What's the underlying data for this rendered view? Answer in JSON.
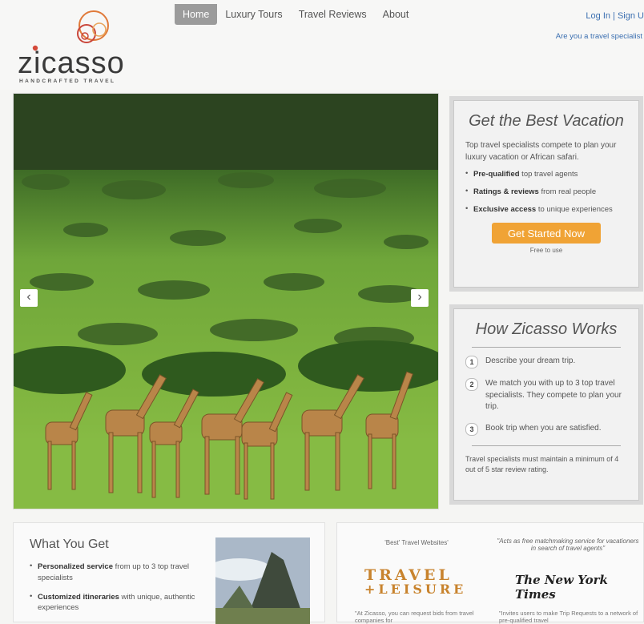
{
  "logo": {
    "name": "zicasso",
    "tagline": "HANDCRAFTED TRAVEL"
  },
  "nav": [
    {
      "label": "Home",
      "active": true
    },
    {
      "label": "Luxury Tours",
      "active": false
    },
    {
      "label": "Travel Reviews",
      "active": false
    },
    {
      "label": "About",
      "active": false
    }
  ],
  "header": {
    "login": "Log In | Sign U",
    "specialist": "Are you a travel specialist"
  },
  "hero": {
    "prev_icon": "chevron-left-icon",
    "next_icon": "chevron-right-icon",
    "prev_glyph": "‹",
    "next_glyph": "›"
  },
  "vacation_panel": {
    "title": "Get the Best Vacation",
    "intro": "Top travel specialists compete to plan your luxury vacation or African safari.",
    "bullets": [
      {
        "strong": "Pre-qualified",
        "rest": " top travel agents"
      },
      {
        "strong": "Ratings & reviews",
        "rest": " from real people"
      },
      {
        "strong": "Exclusive access",
        "rest": " to unique experiences"
      }
    ],
    "cta": "Get Started Now",
    "cta_note": "Free to use",
    "cta_color": "#f0a335"
  },
  "how_panel": {
    "title": "How Zicasso Works",
    "steps": [
      {
        "num": "1",
        "text": "Describe your dream trip."
      },
      {
        "num": "2",
        "text": "We match you with up to 3 top travel specialists. They compete to plan your trip."
      },
      {
        "num": "3",
        "text": "Book trip when you are satisfied."
      }
    ],
    "note": "Travel specialists must maintain a minimum of 4 out of 5 star review rating."
  },
  "what_you_get": {
    "title": "What You Get",
    "items": [
      {
        "strong": "Personalized service",
        "rest": " from up to 3 top travel specialists"
      },
      {
        "strong": "Customized itineraries",
        "rest": " with unique, authentic experiences"
      }
    ]
  },
  "press": {
    "quote_left": "'Best' Travel Websites'",
    "quote_right": "\"Acts as free matchmaking service for vacationers in search of travel agents\"",
    "logo_left_line1": "TRAVEL",
    "logo_left_line2": "+LEISURE",
    "logo_right": "The New York Times",
    "foot_left": "\"At Zicasso, you can request bids from travel companies for",
    "foot_right": "\"Invites users to make Trip Requests to a network of pre-qualified travel"
  }
}
